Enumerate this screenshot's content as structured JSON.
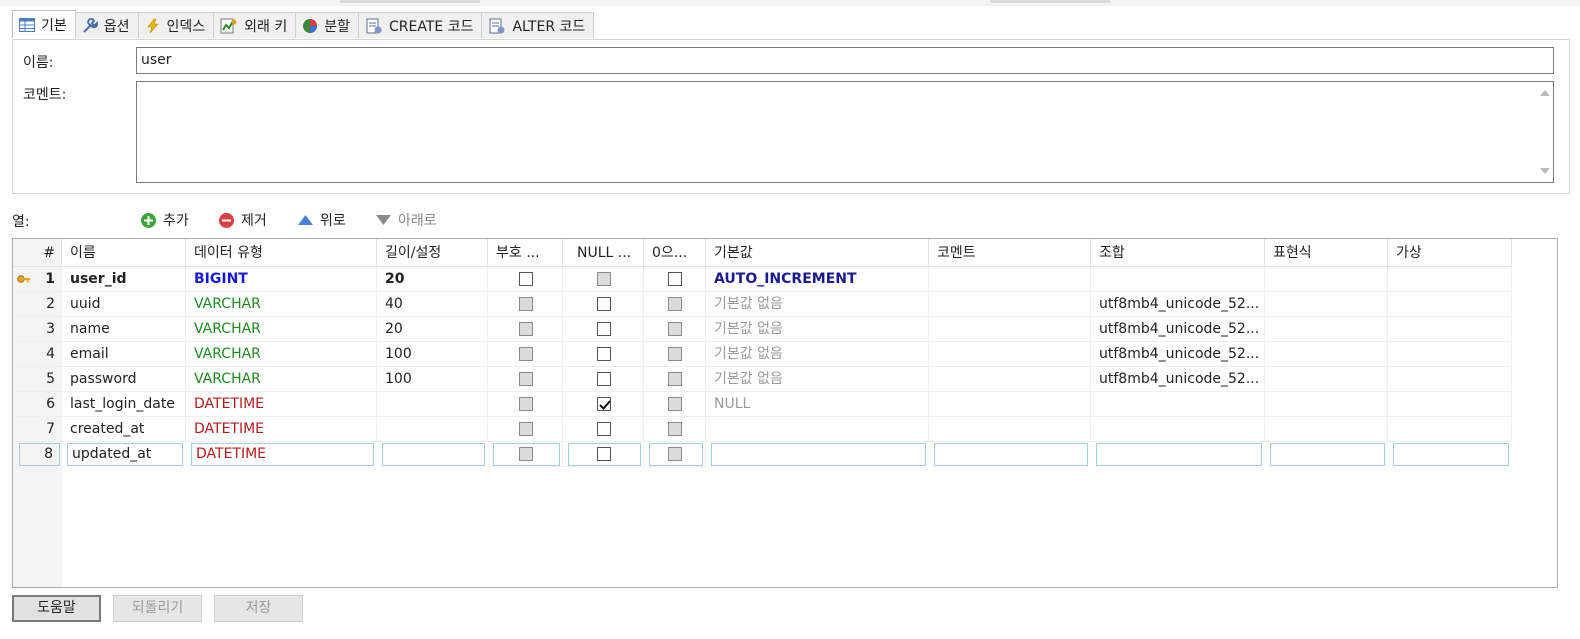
{
  "tabs": [
    {
      "label": "기본",
      "icon": "table-icon",
      "active": true
    },
    {
      "label": "옵션",
      "icon": "wrench-icon"
    },
    {
      "label": "인덱스",
      "icon": "lightning-icon"
    },
    {
      "label": "외래 키",
      "icon": "foreign-key-icon"
    },
    {
      "label": "분할",
      "icon": "partition-icon"
    },
    {
      "label": "CREATE 코드",
      "icon": "code-doc-icon"
    },
    {
      "label": "ALTER 코드",
      "icon": "code-doc-icon"
    }
  ],
  "form": {
    "name_label": "이름:",
    "name_value": "user",
    "comment_label": "코멘트:",
    "comment_value": ""
  },
  "columns_toolbar": {
    "label": "열:",
    "add": "추가",
    "remove": "제거",
    "up": "위로",
    "down": "아래로"
  },
  "grid": {
    "headers": [
      "#",
      "이름",
      "데이터 유형",
      "길이/설정",
      "부호 ...",
      "NULL ...",
      "0으...",
      "기본값",
      "코멘트",
      "조합",
      "표현식",
      "가상"
    ],
    "rows": [
      {
        "num": "1",
        "name": "user_id",
        "type": "BIGINT",
        "length": "20",
        "unsigned": false,
        "nullable": false,
        "zerofill": false,
        "default": "AUTO_INCREMENT",
        "comment": "",
        "collation": "",
        "expression": "",
        "virtual": "",
        "primary": true
      },
      {
        "num": "2",
        "name": "uuid",
        "type": "VARCHAR",
        "length": "40",
        "unsigned": false,
        "nullable": false,
        "zerofill": false,
        "default": "기본값 없음",
        "comment": "",
        "collation": "utf8mb4_unicode_52...",
        "expression": "",
        "virtual": ""
      },
      {
        "num": "3",
        "name": "name",
        "type": "VARCHAR",
        "length": "20",
        "unsigned": false,
        "nullable": false,
        "zerofill": false,
        "default": "기본값 없음",
        "comment": "",
        "collation": "utf8mb4_unicode_52...",
        "expression": "",
        "virtual": ""
      },
      {
        "num": "4",
        "name": "email",
        "type": "VARCHAR",
        "length": "100",
        "unsigned": false,
        "nullable": false,
        "zerofill": false,
        "default": "기본값 없음",
        "comment": "",
        "collation": "utf8mb4_unicode_52...",
        "expression": "",
        "virtual": ""
      },
      {
        "num": "5",
        "name": "password",
        "type": "VARCHAR",
        "length": "100",
        "unsigned": false,
        "nullable": false,
        "zerofill": false,
        "default": "기본값 없음",
        "comment": "",
        "collation": "utf8mb4_unicode_52...",
        "expression": "",
        "virtual": ""
      },
      {
        "num": "6",
        "name": "last_login_date",
        "type": "DATETIME",
        "length": "",
        "unsigned": false,
        "nullable": true,
        "zerofill": false,
        "default": "NULL",
        "comment": "",
        "collation": "",
        "expression": "",
        "virtual": ""
      },
      {
        "num": "7",
        "name": "created_at",
        "type": "DATETIME",
        "length": "",
        "unsigned": false,
        "nullable": false,
        "zerofill": false,
        "default": "",
        "comment": "",
        "collation": "",
        "expression": "",
        "virtual": ""
      },
      {
        "num": "8",
        "name": "updated_at",
        "type": "DATETIME",
        "length": "",
        "unsigned": false,
        "nullable": false,
        "zerofill": false,
        "default": "",
        "comment": "",
        "collation": "",
        "expression": "",
        "virtual": "",
        "editing": true
      }
    ]
  },
  "buttons": {
    "help": "도움말",
    "revert": "되돌리기",
    "save": "저장"
  },
  "colors": {
    "bigint": "#1a1ad4",
    "varchar": "#1f8a1f",
    "datetime": "#b01c1c",
    "muted": "#9a9a9a",
    "auto_increment": "#1a1a8c",
    "edit_border": "#9fcdef"
  }
}
